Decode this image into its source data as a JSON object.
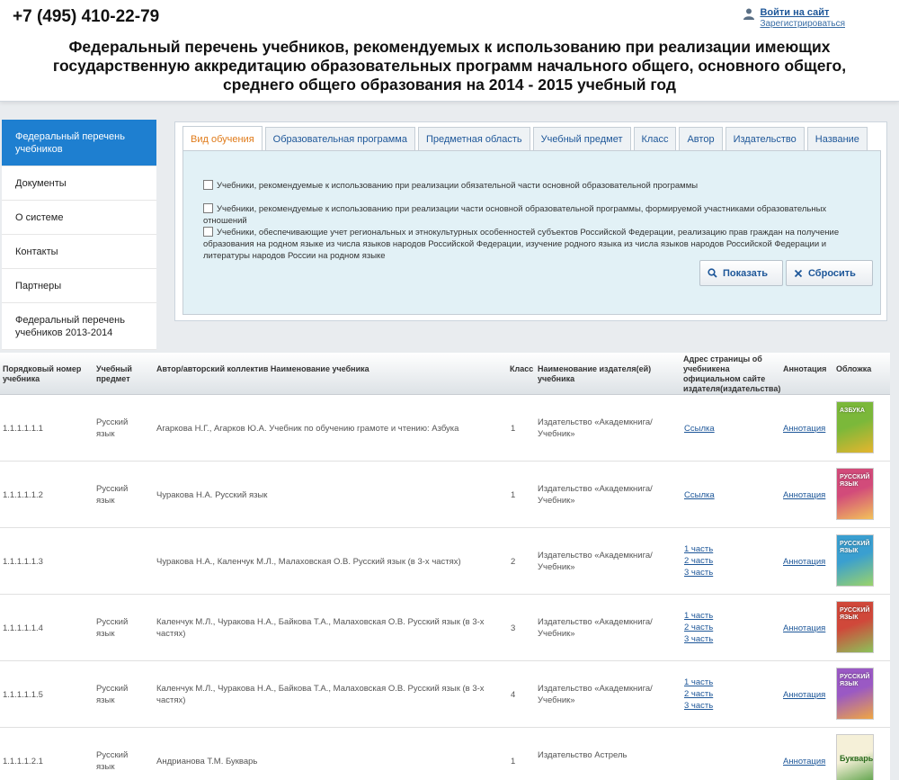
{
  "header": {
    "phone": "+7 (495) 410-22-79",
    "signin": "Войти на сайт",
    "register": "Зарегистрироваться",
    "title": "Федеральный перечень учебников, рекомендуемых к использованию при реализации имеющих государственную аккредитацию образовательных программ начального общего, основного общего, среднего общего образования на 2014 - 2015 учебный год"
  },
  "sidebar": {
    "items": [
      {
        "label": "Федеральный перечень учебников"
      },
      {
        "label": "Документы"
      },
      {
        "label": "О системе"
      },
      {
        "label": "Контакты"
      },
      {
        "label": "Партнеры"
      },
      {
        "label": "Федеральный перечень учебников 2013-2014"
      }
    ]
  },
  "filters": {
    "tabs": [
      "Вид обучения",
      "Образовательная программа",
      "Предметная область",
      "Учебный предмет",
      "Класс",
      "Автор",
      "Издательство",
      "Название"
    ],
    "options": [
      "Учебники, рекомендуемые к использованию при реализации обязательной части основной образовательной программы",
      "Учебники, рекомендуемые к использованию при реализации части основной образовательной программы, формируемой участниками образовательных отношений",
      "Учебники, обеспечивающие учет региональных и этнокультурных особенностей субъектов Российской Федерации, реализацию прав граждан на получение образования на родном языке из числа языков народов Российской Федерации, изучение родного языка из числа языков народов Российской Федерации и литературы народов России на родном языке"
    ],
    "show_label": "Показать",
    "reset_label": "Сбросить"
  },
  "table": {
    "headers": {
      "number": "Порядковый номер учебника",
      "subject": "Учебный предмет",
      "author": "Автор/авторский коллектив Наименование учебника",
      "grade": "Класс",
      "publisher": "Наименование издателя(ей) учебника",
      "url": "Адрес страницы об учебникена официальном сайте издателя(издательства)",
      "annotation": "Аннотация",
      "cover": "Обложка"
    },
    "rows": [
      {
        "number": "1.1.1.1.1.1",
        "subject": "Русский язык",
        "author": "Агаркова Н.Г., Агарков Ю.А. Учебник по обучению грамоте и чтению: Азбука",
        "grade": "1",
        "publisher": "Издательство «Академкнига/Учебник»",
        "links": [
          "Ссылка"
        ],
        "annotation": "Аннотация",
        "cover": "АЗБУКА"
      },
      {
        "number": "1.1.1.1.1.2",
        "subject": "Русский язык",
        "author": "Чуракова Н.А. Русский язык",
        "grade": "1",
        "publisher": "Издательство «Академкнига/Учебник»",
        "links": [
          "Ссылка"
        ],
        "annotation": "Аннотация",
        "cover": "РУССКИЙ ЯЗЫК"
      },
      {
        "number": "1.1.1.1.1.3",
        "subject": "",
        "author": "Чуракова Н.А., Каленчук М.Л., Малаховская О.В. Русский язык (в 3-х частях)",
        "grade": "2",
        "publisher": "Издательство «Академкнига/Учебник»",
        "links": [
          "1 часть",
          "2 часть",
          "3 часть"
        ],
        "annotation": "Аннотация",
        "cover": "РУССКИЙ ЯЗЫК"
      },
      {
        "number": "1.1.1.1.1.4",
        "subject": "Русский язык",
        "author": "Каленчук М.Л., Чуракова Н.А., Байкова Т.А., Малаховская О.В. Русский язык (в 3-х частях)",
        "grade": "3",
        "publisher": "Издательство «Академкнига/Учебник»",
        "links": [
          "1 часть",
          "2 часть",
          "3 часть"
        ],
        "annotation": "Аннотация",
        "cover": "РУССКИЙ ЯЗЫК"
      },
      {
        "number": "1.1.1.1.1.5",
        "subject": "Русский язык",
        "author": "Каленчук М.Л., Чуракова Н.А., Байкова Т.А., Малаховская О.В. Русский язык (в 3-х частях)",
        "grade": "4",
        "publisher": "Издательство «Академкнига/Учебник»",
        "links": [
          "1 часть",
          "2 часть",
          "3 часть"
        ],
        "annotation": "Аннотация",
        "cover": "РУССКИЙ ЯЗЫК"
      },
      {
        "number": "1.1.1.1.2.1",
        "subject": "Русский язык",
        "author": "Андрианова Т.М. Букварь",
        "grade": "1",
        "publisher": "Издательство Астрель",
        "links": [],
        "annotation": "Аннотация",
        "cover": "Букварь"
      }
    ]
  },
  "colors": {
    "accent": "#1e7fd0",
    "link": "#1e5799",
    "active_tab": "#e07b1a",
    "panel_bg": "#e2f1f6"
  }
}
